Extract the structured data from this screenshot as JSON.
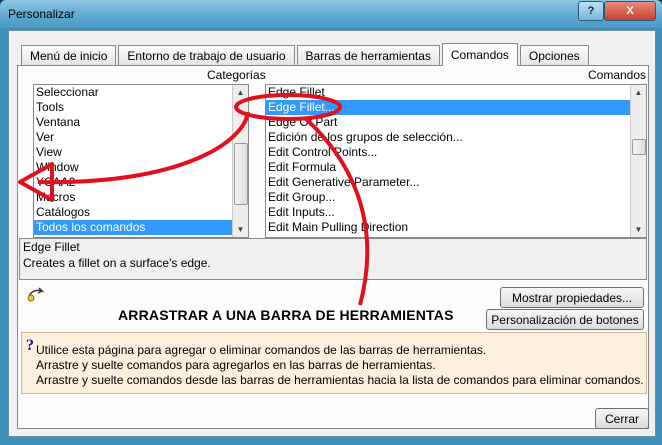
{
  "window": {
    "title": "Personalizar",
    "help_label": "?",
    "close_label": "X"
  },
  "tabs": [
    {
      "label": "Menú de inicio"
    },
    {
      "label": "Entorno de trabajo de usuario"
    },
    {
      "label": "Barras de herramientas"
    },
    {
      "label": "Comandos",
      "active": true
    },
    {
      "label": "Opciones"
    }
  ],
  "categories": {
    "header": "Categorías",
    "items": [
      "Seleccionar",
      "Tools",
      "Ventana",
      "Ver",
      "View",
      "Window",
      "YCAA2",
      "Macros",
      "Catálogos",
      "Todos los comandos"
    ],
    "selected": "Todos los comandos"
  },
  "commands": {
    "header": "Comandos",
    "items": [
      "Edge Fillet",
      "Edge Fillet...",
      "Edge Of Part",
      "Edición de los grupos de selección...",
      "Edit Control Points...",
      "Edit Formula",
      "Edit Generative Parameter...",
      "Edit Group...",
      "Edit Inputs...",
      "Edit Main Pulling Direction"
    ],
    "selected": "Edge Fillet..."
  },
  "description": {
    "name": "Edge Fillet",
    "text": "Creates a fillet on a surface's edge."
  },
  "annotation": "ARRASTRAR A UNA BARRA DE HERRAMIENTAS",
  "buttons": {
    "properties": "Mostrar propiedades...",
    "customize": "Personalización de botones",
    "close": "Cerrar"
  },
  "info": {
    "icon": "?",
    "lines": [
      "Utilice esta página para agregar o eliminar comandos de las barras de herramientas.",
      "Arrastre y suelte comandos para agregarlos en las barras de herramientas.",
      "Arrastre y suelte comandos desde las barras de herramientas hacia la lista de comandos para eliminar comandos."
    ]
  },
  "colors": {
    "selection": "#3399ff",
    "annotation_red": "#e0101e",
    "info_bg": "#fcf0dc"
  }
}
